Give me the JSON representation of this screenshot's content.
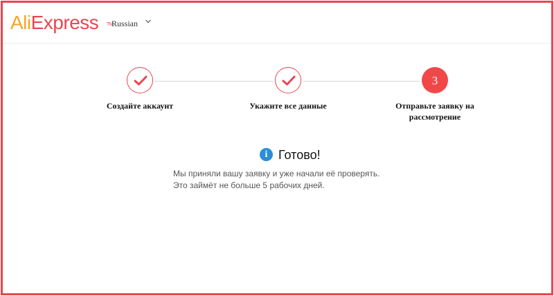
{
  "header": {
    "logo_ali": "Ali",
    "logo_express": "Express",
    "logo_tm": "TM",
    "language": "Russian"
  },
  "steps": [
    {
      "label": "Создайте аккаунт",
      "state": "done"
    },
    {
      "label": "Укажите все данные",
      "state": "done"
    },
    {
      "number": "3",
      "label_line1": "Отправьте заявку на",
      "label_line2": "рассмотрение",
      "state": "active"
    }
  ],
  "result": {
    "icon": "info-icon",
    "icon_glyph": "i",
    "title": "Готово!",
    "message": "Мы приняли вашу заявку и уже начали её проверять. Это займёт не больше 5 рабочих дней."
  },
  "colors": {
    "accent": "#e8464f",
    "logo_orange": "#f5a623",
    "info_blue": "#2b8ed8",
    "step_active": "#f04848"
  }
}
